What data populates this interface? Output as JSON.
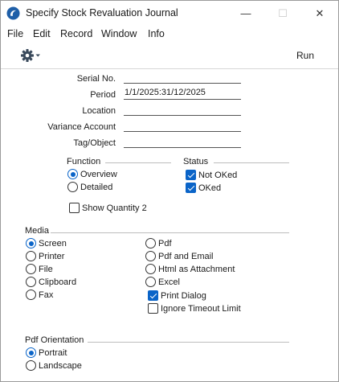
{
  "window": {
    "title": "Specify Stock Revaluation Journal",
    "minimize": "—",
    "maximize": "☐",
    "close": "✕"
  },
  "menu": [
    "File",
    "Edit",
    "Record",
    "Window",
    "Info"
  ],
  "toolbar": {
    "run_label": "Run",
    "settings_icon": "gear-icon"
  },
  "fields": {
    "serial_no": {
      "label": "Serial No.",
      "value": ""
    },
    "period": {
      "label": "Period",
      "value": "1/1/2025:31/12/2025"
    },
    "location": {
      "label": "Location",
      "value": ""
    },
    "variance_account": {
      "label": "Variance Account",
      "value": ""
    },
    "tag_object": {
      "label": "Tag/Object",
      "value": ""
    }
  },
  "function": {
    "title": "Function",
    "options": [
      {
        "label": "Overview",
        "selected": true
      },
      {
        "label": "Detailed",
        "selected": false
      }
    ]
  },
  "status": {
    "title": "Status",
    "options": [
      {
        "label": "Not OKed",
        "checked": true
      },
      {
        "label": "OKed",
        "checked": true
      }
    ]
  },
  "show_quantity_2": {
    "label": "Show Quantity 2",
    "checked": false
  },
  "media": {
    "title": "Media",
    "options": [
      {
        "label": "Screen",
        "selected": true
      },
      {
        "label": "Printer",
        "selected": false
      },
      {
        "label": "File",
        "selected": false
      },
      {
        "label": "Clipboard",
        "selected": false
      },
      {
        "label": "Fax",
        "selected": false
      },
      {
        "label": "Pdf",
        "selected": false
      },
      {
        "label": "Pdf and Email",
        "selected": false
      },
      {
        "label": "Html as Attachment",
        "selected": false
      },
      {
        "label": "Excel",
        "selected": false
      }
    ],
    "print_dialog": {
      "label": "Print Dialog",
      "checked": true
    },
    "ignore_timeout": {
      "label": "Ignore Timeout Limit",
      "checked": false
    }
  },
  "pdf_orientation": {
    "title": "Pdf Orientation",
    "options": [
      {
        "label": "Portrait",
        "selected": true
      },
      {
        "label": "Landscape",
        "selected": false
      }
    ]
  },
  "colors": {
    "accent": "#0a64c8"
  }
}
